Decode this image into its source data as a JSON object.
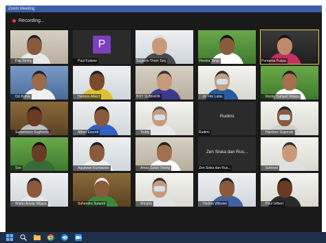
{
  "window": {
    "title": "Zoom Meeting"
  },
  "recording": {
    "label": "Recording..."
  },
  "participants": [
    {
      "name": "Pak Jimmy",
      "muted": true,
      "scene": "room",
      "skin": "#8a5a3c",
      "shirt": "#e8e8e8",
      "hair": "#222"
    },
    {
      "name": "Paul Kulanw",
      "muted": true,
      "avatar": "P"
    },
    {
      "name": "Sugiarto Thom Tanj",
      "muted": false,
      "scene": "light",
      "skin": "#c99a7a",
      "shirt": "#4a4a4a",
      "hair": "#ddd"
    },
    {
      "name": "Hendra Tanja",
      "muted": false,
      "scene": "green",
      "skin": "#8a5a3c",
      "shirt": "#ffffff",
      "hair": "#111"
    },
    {
      "name": "Purnama Puspa",
      "muted": false,
      "scene": "dark",
      "skin": "#c08a6a",
      "shirt": "#c03060",
      "hair": "#111",
      "active": true
    },
    {
      "name": "Ozi Koma",
      "muted": true,
      "scene": "blue",
      "skin": "#9a6a4a",
      "shirt": "#f0f0f0",
      "hair": "#222"
    },
    {
      "name": "Hartono Albert",
      "muted": true,
      "scene": "light",
      "skin": "#7a4a2c",
      "shirt": "#e0c030",
      "hair": "#222"
    },
    {
      "name": "BOY SUBRATA",
      "muted": false,
      "scene": "room",
      "skin": "#c99a7a",
      "shirt": "#3a3a8a",
      "hair": "#333"
    },
    {
      "name": "dr. Fitri Lubis",
      "muted": true,
      "scene": "bright",
      "skin": "#c8a080",
      "shirt": "#2a5aa0",
      "hair": "#333",
      "mask": true
    },
    {
      "name": "Rocky Tjahjadi Wijaya",
      "muted": true,
      "scene": "green",
      "skin": "#a07050",
      "shirt": "#ffffff",
      "hair": "#222"
    },
    {
      "name": "Sudarmono Sugiharto",
      "muted": true,
      "scene": "wood",
      "skin": "#6a3a24",
      "shirt": "#c0c0c0",
      "hair": "#111"
    },
    {
      "name": "Albert Everett",
      "muted": true,
      "scene": "light",
      "skin": "#8a5a3c",
      "shirt": "#3060c0",
      "hair": "#111"
    },
    {
      "name": "Teddy",
      "muted": true,
      "scene": "bright",
      "skin": "#c99a7a",
      "shirt": "#e8e8e8",
      "hair": "#555",
      "mask": true
    },
    {
      "name": "Rudimi",
      "muted": false,
      "textonly": true
    },
    {
      "name": "Hardono Sugondo",
      "muted": true,
      "scene": "bright",
      "skin": "#8a5a3c",
      "shirt": "#d0d0d0",
      "hair": "#222",
      "mask": true
    },
    {
      "name": "Son",
      "muted": true,
      "scene": "green",
      "skin": "#6a3a24",
      "shirt": "#3a6a3a",
      "hair": "#111"
    },
    {
      "name": "Aguswan Kurniawan",
      "muted": true,
      "scene": "light",
      "skin": "#8a5a3c",
      "shirt": "#f0f0f0",
      "hair": "#222"
    },
    {
      "name": "Amos Sutan Tobing",
      "muted": true,
      "scene": "room",
      "skin": "#a07050",
      "shirt": "#ffffff",
      "hair": "#222"
    },
    {
      "name": "Zen Siska dan Rus...",
      "muted": false,
      "textonly": true
    },
    {
      "name": "Sutrisno",
      "muted": true,
      "scene": "bright",
      "skin": "#c99a7a",
      "shirt": "#e0e0e0",
      "hair": "#333"
    },
    {
      "name": "Wisnu Anwar Wijaya",
      "muted": true,
      "scene": "light",
      "skin": "#8a5a3c",
      "shirt": "#e8e8e8",
      "hair": "#222"
    },
    {
      "name": "Suhendra Sutandi",
      "muted": true,
      "scene": "wood",
      "skin": "#8a5a3c",
      "shirt": "#3a8a3a",
      "hair": "#f0f0f0"
    },
    {
      "name": "Winarto",
      "muted": true,
      "scene": "bright",
      "skin": "#c99a7a",
      "shirt": "#e0e0e0",
      "hair": "#333",
      "mask": true
    },
    {
      "name": "Herlina Wibowo",
      "muted": true,
      "scene": "light",
      "skin": "#8a5a3c",
      "shirt": "#4060a0",
      "hair": "#222"
    },
    {
      "name": "Paul Gilbert",
      "muted": true,
      "scene": "bright",
      "skin": "#6a3a24",
      "shirt": "#2a2a2a",
      "hair": "#111"
    }
  ],
  "colors": {
    "title_bar": "#3a5fa8",
    "background": "#1a1a1a",
    "taskbar": "#1d3047",
    "active_border": "#e8d04a",
    "muted_icon": "#e04040"
  },
  "taskbar": {
    "icons": [
      "windows-start-icon",
      "search-icon",
      "file-explorer-icon",
      "chrome-icon",
      "edge-icon",
      "zoom-icon"
    ]
  }
}
